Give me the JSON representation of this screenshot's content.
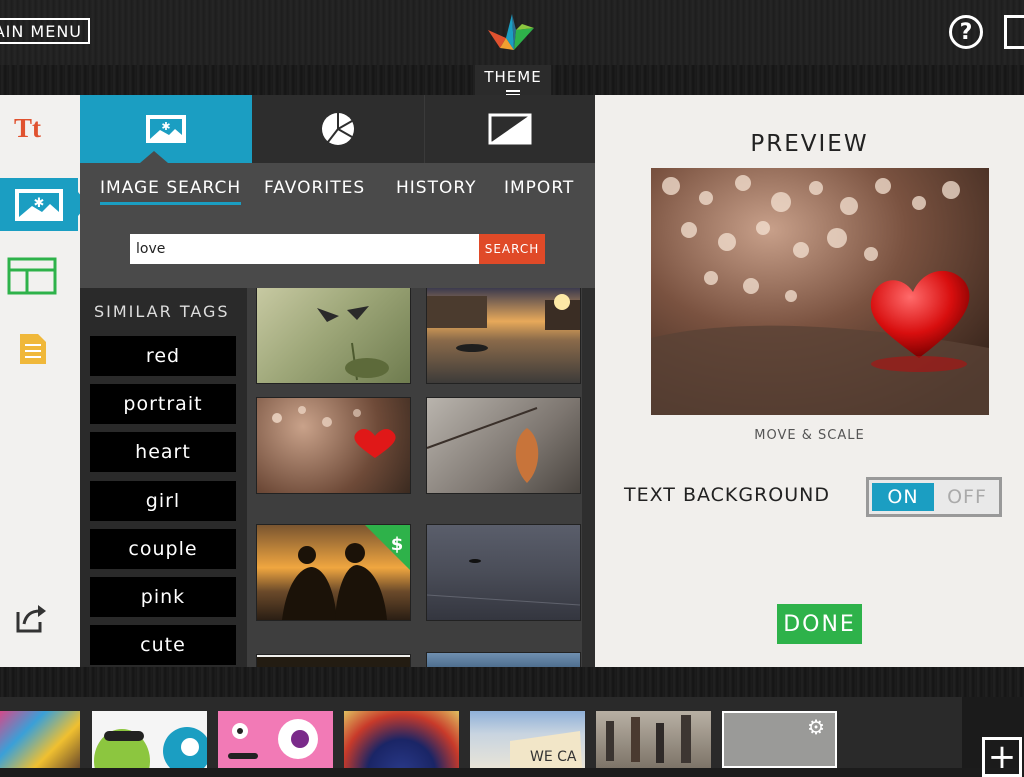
{
  "header": {
    "main_menu_label": "AIN MENU",
    "help_label": "?",
    "theme_label": "THEME"
  },
  "left_rail": {
    "items": [
      {
        "name": "text",
        "label": "Tt"
      },
      {
        "name": "image",
        "icon": "image-icon"
      },
      {
        "name": "layout",
        "icon": "layout-icon"
      },
      {
        "name": "notes",
        "icon": "notes-icon"
      },
      {
        "name": "share",
        "icon": "share-icon"
      }
    ]
  },
  "panel": {
    "tabs": [
      {
        "icon": "image-icon",
        "active": true
      },
      {
        "icon": "pie-chart-icon",
        "active": false
      },
      {
        "icon": "background-icon",
        "active": false
      }
    ],
    "subtabs": [
      "IMAGE SEARCH",
      "FAVORITES",
      "HISTORY",
      "IMPORT"
    ],
    "search": {
      "value": "love",
      "button_label": "SEARCH"
    },
    "similar_tags": {
      "title": "SIMILAR TAGS",
      "tags": [
        "red",
        "portrait",
        "heart",
        "girl",
        "couple",
        "pink",
        "cute"
      ]
    },
    "results": {
      "premium_badge": "$",
      "thumbnails": [
        "birds",
        "canal-sunset",
        "red-heart",
        "autumn-leaf",
        "couple-silhouette",
        "lone-boat",
        "partial-1",
        "partial-2"
      ]
    }
  },
  "preview": {
    "title": "PREVIEW",
    "move_scale_label": "MOVE & SCALE",
    "text_background_label": "TEXT BACKGROUND",
    "toggle_on": "ON",
    "toggle_off": "OFF",
    "text_background_state": "on",
    "done_label": "DONE"
  },
  "slides_strip": {
    "slides": [
      "paint-face",
      "green-monster",
      "pink-monster",
      "blue-red-circle",
      "we-can-sign",
      "crowd-street",
      "empty-slide"
    ],
    "add_label": "+"
  },
  "colors": {
    "accent_blue": "#1b9ec2",
    "search_red": "#e04a28",
    "done_green": "#2eb24a"
  }
}
